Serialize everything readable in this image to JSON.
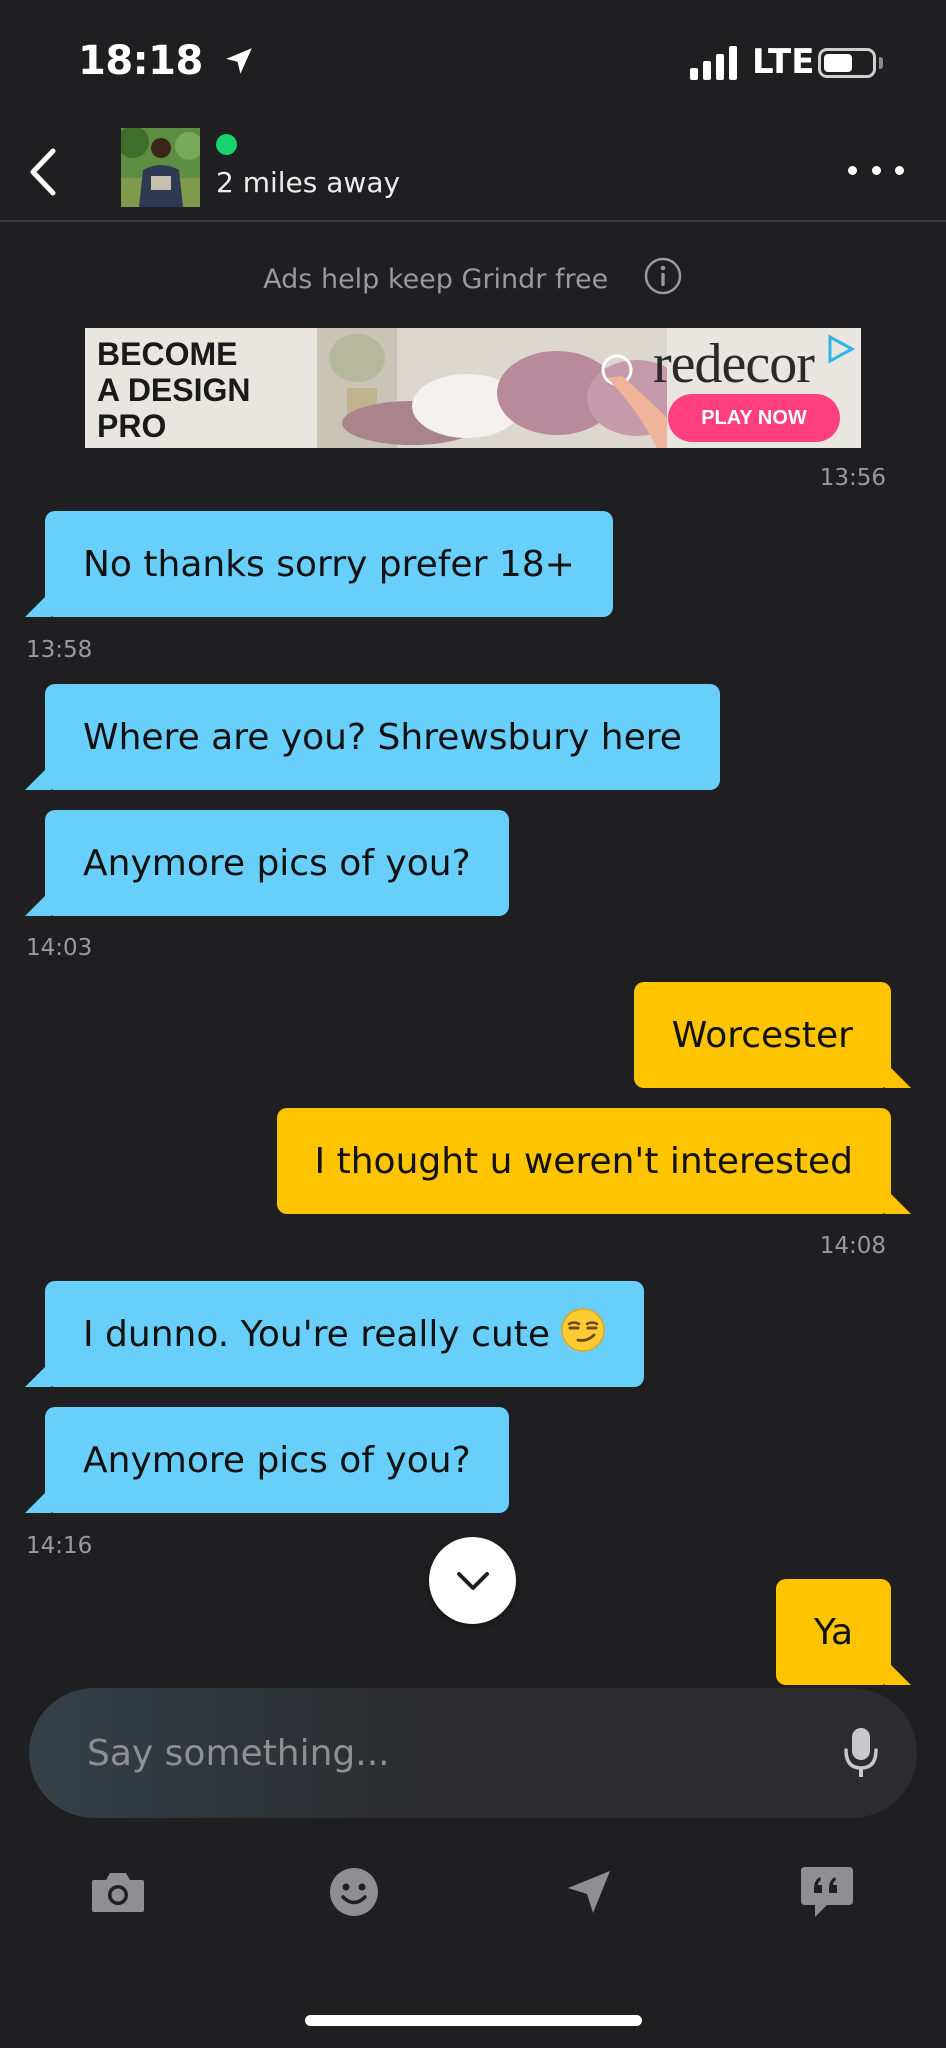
{
  "status_bar": {
    "time": "18:18",
    "network": "LTE"
  },
  "header": {
    "distance": "2 miles away"
  },
  "ads": {
    "note": "Ads help keep Grindr free",
    "banner": {
      "headline_line1": "BECOME",
      "headline_line2": "A DESIGN",
      "headline_line3": "PRO",
      "brand": "redecor",
      "cta": "PLAY NOW"
    }
  },
  "messages": [
    {
      "type": "timestamp",
      "side": "right",
      "text": "13:56"
    },
    {
      "type": "message",
      "direction": "incoming",
      "text": "No thanks sorry prefer 18+"
    },
    {
      "type": "timestamp",
      "side": "left",
      "text": "13:58"
    },
    {
      "type": "message",
      "direction": "incoming",
      "text": "Where are you?  Shrewsbury here"
    },
    {
      "type": "message",
      "direction": "incoming",
      "text": "Anymore pics of you?"
    },
    {
      "type": "timestamp",
      "side": "left",
      "text": "14:03"
    },
    {
      "type": "message",
      "direction": "outgoing",
      "text": "Worcester"
    },
    {
      "type": "message",
      "direction": "outgoing",
      "text": "I thought u weren't interested"
    },
    {
      "type": "timestamp",
      "side": "right",
      "text": "14:08"
    },
    {
      "type": "message",
      "direction": "incoming",
      "text": "I dunno. You're really cute",
      "emoji": "smirk"
    },
    {
      "type": "message",
      "direction": "incoming",
      "text": "Anymore pics of you?"
    },
    {
      "type": "timestamp",
      "side": "left",
      "text": "14:16"
    },
    {
      "type": "message",
      "direction": "outgoing",
      "text": "Ya"
    }
  ],
  "composer": {
    "placeholder": "Say something..."
  },
  "toolbar": {
    "icons": [
      "camera-icon",
      "emoji-icon",
      "location-icon",
      "saved-phrases-icon"
    ]
  },
  "colors": {
    "background": "#1f1f21",
    "incoming_bubble": "#68cffb",
    "outgoing_bubble": "#ffc400",
    "online": "#19d26b",
    "ad_cta": "#ff3f7f"
  }
}
